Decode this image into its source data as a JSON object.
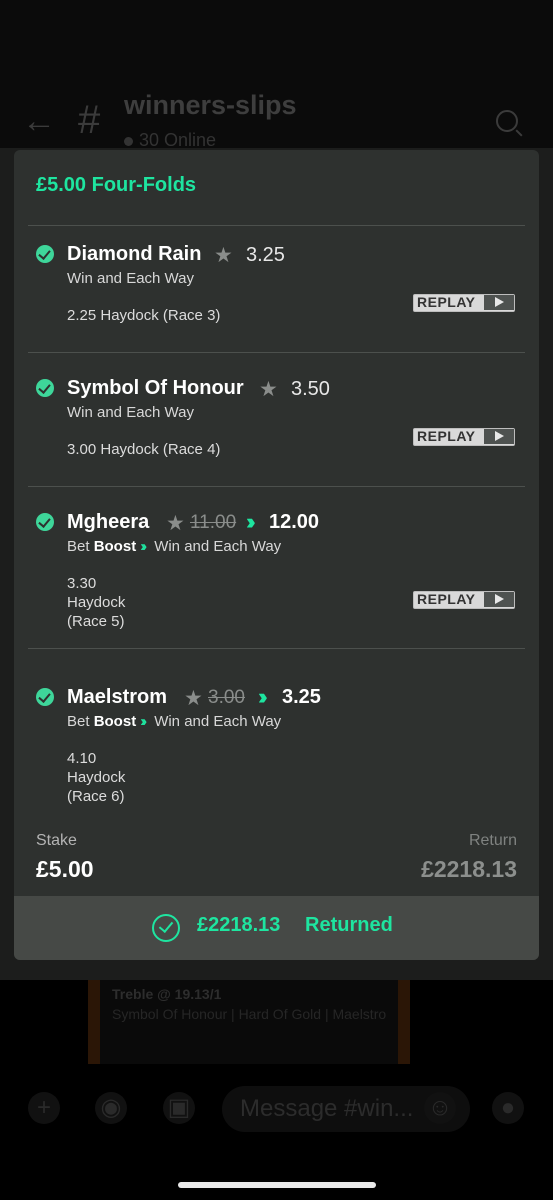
{
  "background": {
    "channel": "winners-slips",
    "online": "30 Online",
    "post_title": "Treble @ 19.13/1",
    "post_text": "Symbol Of Honour | Hard Of Gold | Maelstrom",
    "composer_placeholder": "Message #win..."
  },
  "slip": {
    "title": "£5.00 Four-Folds",
    "legs": [
      {
        "horse": "Diamond Rain",
        "odds": "3.25",
        "market": "Win and Each Way",
        "race": "2.25 Haydock (Race 3)",
        "replay": "REPLAY"
      },
      {
        "horse": "Symbol Of Honour",
        "odds": "3.50",
        "market": "Win and Each Way",
        "race": "3.00 Haydock (Race 4)",
        "replay": "REPLAY"
      },
      {
        "horse": "Mgheera",
        "odds_old": "11.00",
        "odds_new": "12.00",
        "boost_prefix": "Bet",
        "boost_word": "Boost",
        "market": "Win and Each Way",
        "race_time": "3.30",
        "race_course": "Haydock",
        "race_no": "(Race 5)",
        "replay": "REPLAY"
      },
      {
        "horse": "Maelstrom",
        "odds_old": "3.00",
        "odds_new": "3.25",
        "boost_prefix": "Bet",
        "boost_word": "Boost",
        "market": "Win and Each Way",
        "race_time": "4.10",
        "race_course": "Haydock",
        "race_no": "(Race 6)"
      }
    ],
    "stake_label": "Stake",
    "stake": "£5.00",
    "return_label": "Return",
    "return": "£2218.13",
    "returned_amount": "£2218.13",
    "returned_label": "Returned"
  },
  "colors": {
    "accent": "#1ee5a0",
    "sheet": "#2e312f",
    "check": "#3ed69a"
  }
}
